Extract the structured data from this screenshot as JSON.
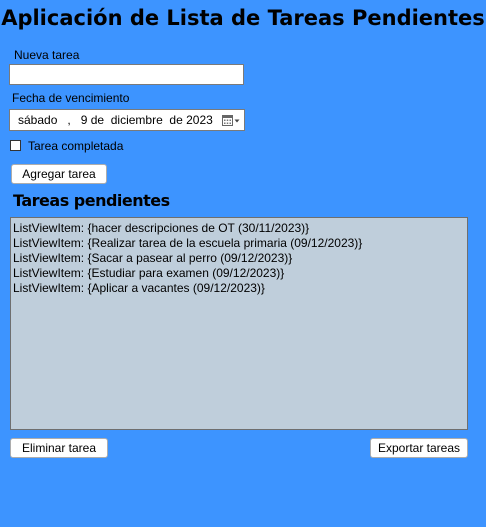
{
  "app": {
    "title": "Aplicación de Lista de Tareas Pendientes"
  },
  "form": {
    "new_task_label": "Nueva tarea",
    "new_task_value": "",
    "due_date_label": "Fecha de vencimiento",
    "due_date_value": "sábado   ,   9 de  diciembre  de 2023",
    "completed_label": "Tarea completada",
    "completed_checked": false,
    "add_button": "Agregar tarea"
  },
  "pending": {
    "title": "Tareas pendientes",
    "items": [
      "ListViewItem: {hacer descripciones de OT (30/11/2023)}",
      "ListViewItem: {Realizar tarea de la escuela primaria (09/12/2023)}",
      "ListViewItem: {Sacar a pasear al perro (09/12/2023)}",
      "ListViewItem: {Estudiar para examen (09/12/2023)}",
      "ListViewItem: {Aplicar a vacantes (09/12/2023)}"
    ]
  },
  "actions": {
    "delete_button": "Eliminar tarea",
    "export_button": "Exportar tareas"
  },
  "icons": {
    "calendar": "calendar-icon",
    "dropdown": "chevron-down-icon"
  },
  "colors": {
    "background": "#3d94ff",
    "list_background": "#bfcedb"
  }
}
